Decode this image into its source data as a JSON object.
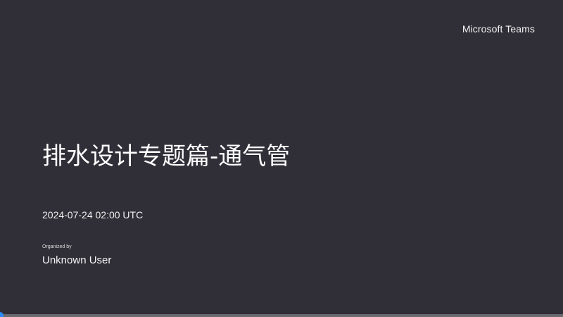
{
  "header": {
    "brand": "Microsoft Teams"
  },
  "meeting": {
    "title": "排水设计专题篇-通气管",
    "datetime": "2024-07-24 02:00 UTC",
    "organized_by_label": "Organized by",
    "organizer": "Unknown User"
  },
  "playback": {
    "progress": 0.0
  },
  "colors": {
    "background": "#302f38",
    "accent": "#2a8cff",
    "track": "#6b6b70"
  }
}
